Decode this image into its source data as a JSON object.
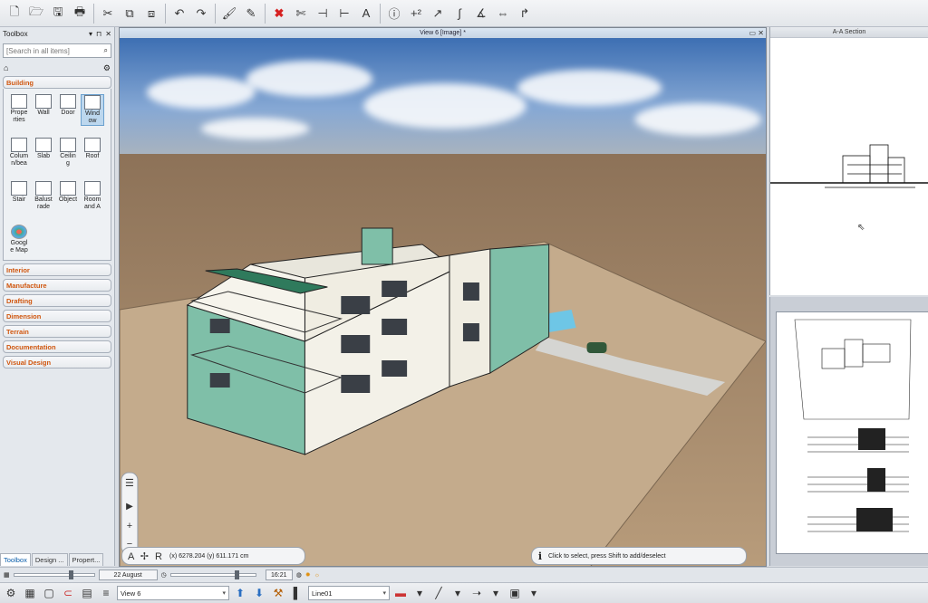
{
  "toolbar": {
    "icons": [
      "new-icon",
      "open-icon",
      "save-icon",
      "print-icon",
      "cut-icon",
      "copy-icon",
      "paste-icon",
      "undo-icon",
      "redo-icon",
      "brush-icon",
      "pen-icon",
      "delete-icon",
      "trim-icon",
      "extend-icon",
      "align-icon",
      "text-icon",
      "info-icon",
      "add-point-icon",
      "arc-tool-icon",
      "curve-tool-icon",
      "angle-tool-icon",
      "arrows-tool-icon",
      "graph-tool-icon"
    ],
    "glyphs": [
      "🗋",
      "🗁",
      "🖫",
      "🖶",
      "✂",
      "⧉",
      "⧈",
      "↶",
      "↷",
      "🖌",
      "✎",
      "✖",
      "✄",
      "⊣",
      "⊢",
      "A",
      "ⓘ",
      "+²",
      "↗",
      "∫",
      "∡",
      "⇔",
      "↱"
    ]
  },
  "toolbox": {
    "title": "Toolbox",
    "search_placeholder": "[Search in all items]",
    "building_label": "Building",
    "tools": [
      {
        "label": "Prope\nrties",
        "name": "properties"
      },
      {
        "label": "Wall",
        "name": "wall"
      },
      {
        "label": "Door",
        "name": "door"
      },
      {
        "label": "Wind\now",
        "name": "window"
      },
      {
        "label": "Colum\nn/bea",
        "name": "column-beam"
      },
      {
        "label": "Slab",
        "name": "slab"
      },
      {
        "label": "Ceilin\ng",
        "name": "ceiling"
      },
      {
        "label": "Roof",
        "name": "roof"
      },
      {
        "label": "Stair",
        "name": "stair"
      },
      {
        "label": "Balust\nrade",
        "name": "balustrade"
      },
      {
        "label": "Object",
        "name": "object"
      },
      {
        "label": "Room\nand A",
        "name": "room-and-area"
      },
      {
        "label": "Googl\ne Map",
        "name": "google-map"
      }
    ],
    "categories": [
      "Interior",
      "Manufacture",
      "Drafting",
      "Dimension",
      "Terrain",
      "Documentation",
      "Visual Design"
    ],
    "tabs": [
      "Toolbox",
      "Design ...",
      "Propert..."
    ]
  },
  "viewport": {
    "title": "View 6 [Image] *",
    "coords": "(x) 6278.204  (y) 611.171 cm",
    "status": "Click to select, press Shift to add/deselect"
  },
  "section_panel": {
    "title": "A-A Section"
  },
  "date_bar": {
    "date": "22 August",
    "time": "16:21"
  },
  "bottom_toolbar": {
    "view_select": "View 6",
    "line_select": "Line01"
  },
  "colors": {
    "accent_orange": "#d0560e",
    "building_teal": "#7fbfa8",
    "sky_blue": "#5d8fc7",
    "ground_sand": "#b59a78"
  }
}
